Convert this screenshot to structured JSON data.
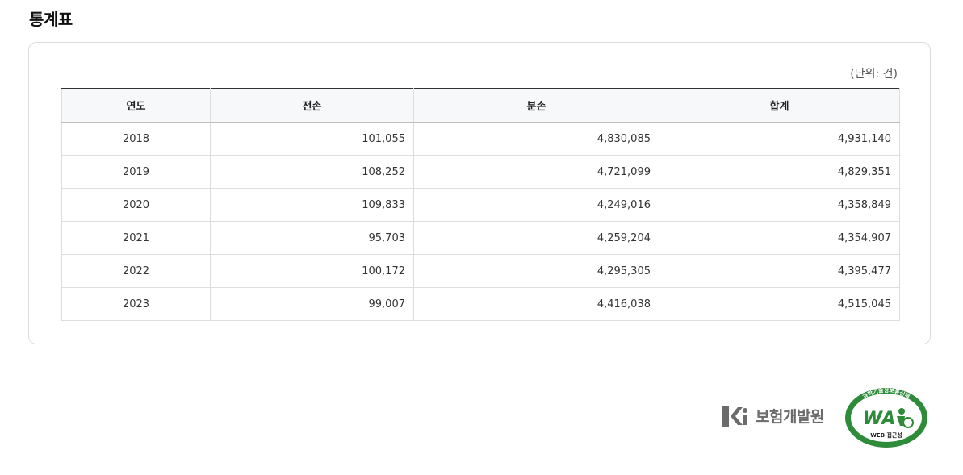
{
  "page": {
    "title": "통계표"
  },
  "table": {
    "unit_note": "(단위: 건)",
    "columns": [
      "연도",
      "전손",
      "분손",
      "합계"
    ],
    "rows": [
      [
        "2018",
        "101,055",
        "4,830,085",
        "4,931,140"
      ],
      [
        "2019",
        "108,252",
        "4,721,099",
        "4,829,351"
      ],
      [
        "2020",
        "109,833",
        "4,249,016",
        "4,358,849"
      ],
      [
        "2021",
        "95,703",
        "4,259,204",
        "4,354,907"
      ],
      [
        "2022",
        "100,172",
        "4,295,305",
        "4,395,477"
      ],
      [
        "2023",
        "99,007",
        "4,416,038",
        "4,515,045"
      ]
    ]
  },
  "footer": {
    "org_name": "보험개발원",
    "org_logo_icon": "kidi-logo-icon",
    "wa_badge": {
      "icon": "web-accessibility-mark-icon",
      "top_text": "과학기술정보통신부",
      "center_text": "WA",
      "bottom_text": "WEB 접근성"
    }
  },
  "colors": {
    "header_bg": "#f7f8fa",
    "table_top_border": "#333333",
    "logo_gray": "#6b6b6b",
    "wa_green": "#2e8b3a"
  }
}
